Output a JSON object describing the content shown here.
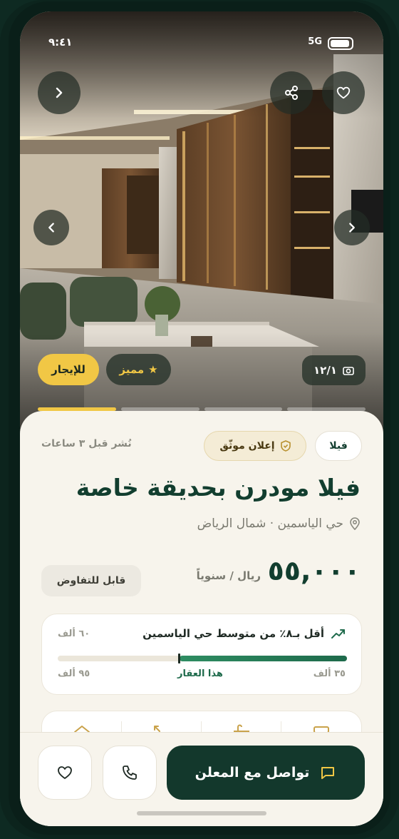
{
  "status": {
    "time": "٩:٤١",
    "network": "5G"
  },
  "gallery": {
    "counter": "١٢/١",
    "slides_total": 4,
    "active_slide": 1,
    "badges": {
      "rent": "للإيجار",
      "featured": "مميز"
    }
  },
  "listing": {
    "type": "فيلا",
    "verified": "إعلان موثّق",
    "posted": "نُشر قبل ٣ ساعات",
    "title": "فيلا مودرن بحديقة خاصة",
    "location": "حي الياسمين · شمال الرياض",
    "price": "٥٥,٠٠٠",
    "price_unit": "ريال / سنوياً",
    "negotiable": "قابل للتفاوض"
  },
  "comparison": {
    "title": "أقل بـ٨٪ من متوسط حي الياسمين",
    "min_label": "٣٥ ألف",
    "max_label": "٦٠ ألف",
    "this_label": "هذا العقار",
    "low_label": "٩٥ ألف",
    "fill_fraction": 0.58
  },
  "features": [
    {
      "icon": "bed-icon"
    },
    {
      "icon": "bath-icon"
    },
    {
      "icon": "area-icon"
    },
    {
      "icon": "house-icon"
    }
  ],
  "actions": {
    "contact": "تواصل مع المعلن"
  },
  "colors": {
    "primary": "#13382c",
    "accent": "#f1c745",
    "background": "#f7f4ec"
  }
}
